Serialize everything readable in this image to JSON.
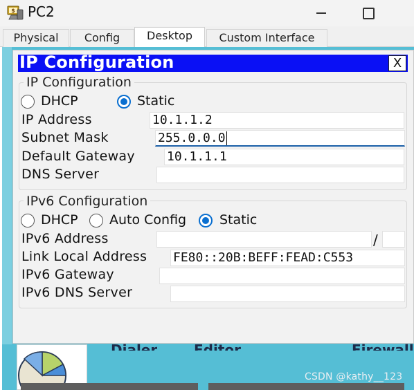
{
  "window": {
    "title": "PC2"
  },
  "tabs": [
    {
      "label": "Physical"
    },
    {
      "label": "Config"
    },
    {
      "label": "Desktop",
      "active": true
    },
    {
      "label": "Custom Interface"
    }
  ],
  "ip_config": {
    "title": "IP Configuration",
    "close_label": "X",
    "ipv4": {
      "group_label": "IP Configuration",
      "mode_dhcp_label": "DHCP",
      "mode_static_label": "Static",
      "selected_mode": "Static",
      "ip_address_label": "IP Address",
      "ip_address_value": "10.1.1.2",
      "subnet_mask_label": "Subnet Mask",
      "subnet_mask_value": "255.0.0.0",
      "default_gateway_label": "Default Gateway",
      "default_gateway_value": "10.1.1.1",
      "dns_server_label": "DNS Server",
      "dns_server_value": ""
    },
    "ipv6": {
      "group_label": "IPv6 Configuration",
      "mode_dhcp_label": "DHCP",
      "mode_auto_label": "Auto Config",
      "mode_static_label": "Static",
      "selected_mode": "Static",
      "ipv6_address_label": "IPv6 Address",
      "ipv6_address_value": "",
      "prefix_separator": "/",
      "prefix_length_value": "",
      "link_local_label": "Link Local Address",
      "link_local_value": "FE80::20B:BEFF:FEAD:C553",
      "ipv6_gateway_label": "IPv6 Gateway",
      "ipv6_gateway_value": "",
      "ipv6_dns_label": "IPv6 DNS Server",
      "ipv6_dns_value": ""
    }
  },
  "desktop_apps": [
    {
      "label": "Dialer"
    },
    {
      "label": "Editor"
    },
    {
      "label": "Firewall"
    }
  ],
  "watermark": "CSDN @kathy__123"
}
